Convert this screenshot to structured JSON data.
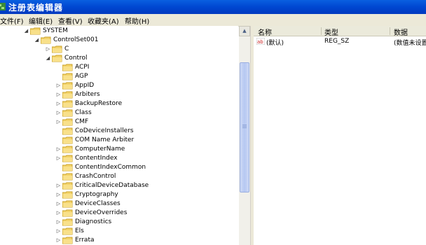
{
  "window": {
    "title": "注册表编辑器"
  },
  "menu": [
    "文件(F)",
    "编辑(E)",
    "查看(V)",
    "收藏夹(A)",
    "帮助(H)"
  ],
  "tree": {
    "system": "SYSTEM",
    "controlset": "ControlSet001",
    "c": "C",
    "control": "Control",
    "children": [
      "ACPI",
      "AGP",
      "AppID",
      "Arbiters",
      "BackupRestore",
      "Class",
      "CMF",
      "CoDeviceInstallers",
      "COM Name Arbiter",
      "ComputerName",
      "ContentIndex",
      "ContentIndexCommon",
      "CrashControl",
      "CriticalDeviceDatabase",
      "Cryptography",
      "DeviceClasses",
      "DeviceOverrides",
      "Diagnostics",
      "Els",
      "Errata"
    ]
  },
  "values_pane": {
    "columns": [
      "名称",
      "类型",
      "数据"
    ],
    "rows": [
      {
        "name": "(默认)",
        "type": "REG_SZ",
        "data": "(数值未设置"
      }
    ]
  }
}
